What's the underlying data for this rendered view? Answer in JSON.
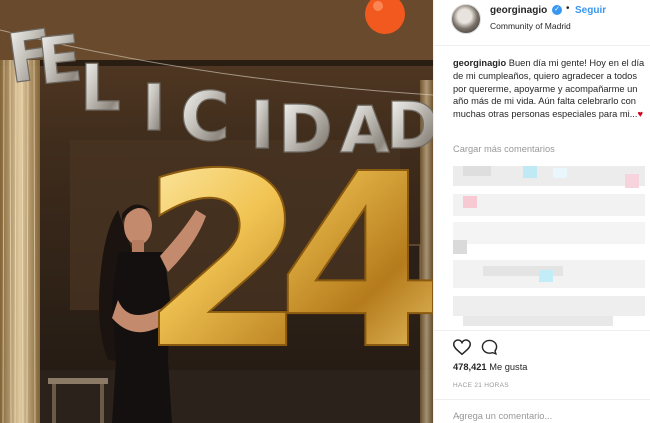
{
  "photo": {
    "banner_letters": [
      "F",
      "E",
      "L",
      "I",
      "C",
      "I",
      "D",
      "A",
      "D"
    ],
    "number_balloon": "24"
  },
  "header": {
    "username": "georginagio",
    "verified_icon": "verified-badge-icon",
    "separator": "•",
    "follow_label": "Seguir",
    "location": "Community of Madrid"
  },
  "caption": {
    "username": "georginagio",
    "text": "Buen día mi gente! Hoy en el día de mi cumpleaños, quiero agradecer a todos por quererme, apoyarme y acompañarme un año más de mi vida. Aún falta celebrarlo con muchas otras personas especiales para mi...",
    "emoji": "♥"
  },
  "comments": {
    "load_more_label": "Cargar más comentarios"
  },
  "actions": {
    "like_icon": "heart-outline-icon",
    "comment_icon": "comment-bubble-icon",
    "likes_count": "478,421",
    "likes_label": "Me gusta",
    "timestamp": "HACE 21 HORAS",
    "add_comment_placeholder": "Agrega un comentario...",
    "more_icon": "more-options-icon",
    "more_glyph": "···"
  },
  "colors": {
    "link_blue": "#3897f0",
    "heart_red": "#d0021b",
    "muted_gray": "#999999",
    "balloon_gold": "#e2b04a",
    "balloon_silver": "#d9d9d9"
  }
}
